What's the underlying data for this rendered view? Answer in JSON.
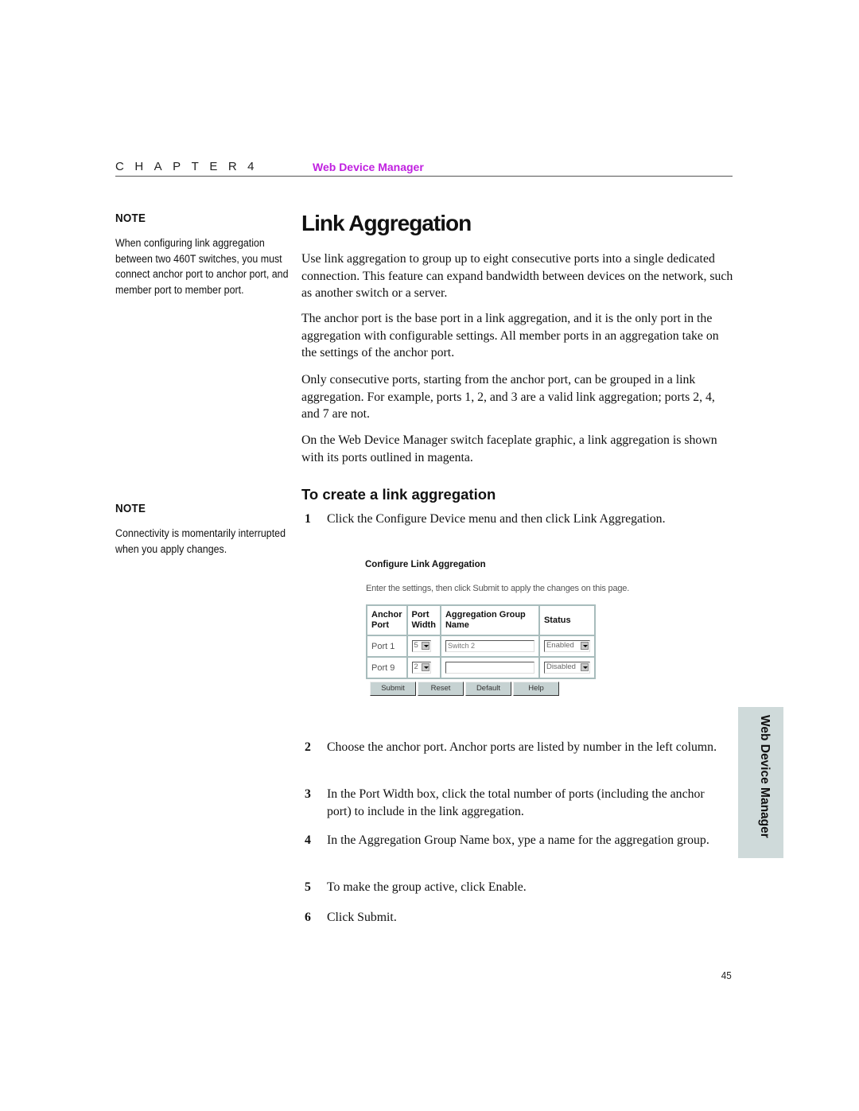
{
  "header": {
    "chapter_label": "CHAPTER 4",
    "chapter_title": "Web Device Manager",
    "accent_color": "#c020e0"
  },
  "notes": [
    {
      "heading": "NOTE",
      "body": "When configuring link aggregation between two 460T switches, you must connect anchor port to anchor port, and member port to member port."
    },
    {
      "heading": "NOTE",
      "body": "Connectivity is momentarily interrupted when you apply changes."
    }
  ],
  "page_title": "Link Aggregation",
  "paragraphs": [
    "Use link aggregation to group up to eight consecutive ports into a single dedicated connection. This feature can expand bandwidth between devices on the network, such as another switch or a server.",
    "The anchor port is the base port in a link aggregation, and it is the only port in the aggregation with configurable settings. All member ports in an aggregation take on the settings of the anchor port.",
    "Only consecutive ports, starting from the anchor port, can be grouped in a link aggregation. For example, ports 1, 2, and 3 are a valid link aggregation; ports 2, 4, and 7 are not.",
    "On the Web Device Manager switch faceplate graphic, a link aggregation is shown with its ports outlined in magenta."
  ],
  "procedure": {
    "heading": "To create a link aggregation",
    "steps": [
      {
        "num": "1",
        "text": "Click the Configure Device menu and then click Link Aggregation."
      },
      {
        "num": "2",
        "text": "Choose the anchor port. Anchor ports are listed by number in the left column."
      },
      {
        "num": "3",
        "text": "In the Port Width box, click the total number of ports (including the anchor port) to include in the link aggregation."
      },
      {
        "num": "4",
        "text": "In the Aggregation Group Name box, ype a name for the aggregation group."
      },
      {
        "num": "5",
        "text": "To make the group active, click Enable."
      },
      {
        "num": "6",
        "text": "Click Submit."
      }
    ]
  },
  "config_screenshot": {
    "title": "Configure Link Aggregation",
    "description": "Enter the settings, then click Submit to apply the changes on this page.",
    "columns": {
      "anchor_port_line1": "Anchor",
      "anchor_port_line2": "Port",
      "port_width_line1": "Port",
      "port_width_line2": "Width",
      "group_name_line1": "Aggregation Group",
      "group_name_line2": "Name",
      "status": "Status"
    },
    "rows": [
      {
        "anchor_port": "Port 1",
        "port_width": "5",
        "group_name": "Switch 2",
        "status": "Enabled"
      },
      {
        "anchor_port": "Port 9",
        "port_width": "2",
        "group_name": "",
        "status": "Disabled"
      }
    ],
    "buttons": {
      "submit": "Submit",
      "reset": "Reset",
      "default": "Default",
      "help": "Help"
    }
  },
  "side_tab": "Web Device Manager",
  "page_number": "45"
}
